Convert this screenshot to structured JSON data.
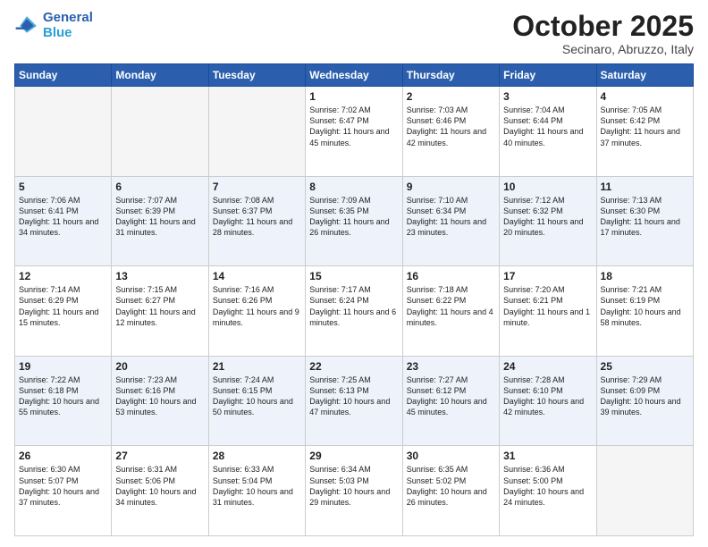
{
  "header": {
    "logo_general": "General",
    "logo_blue": "Blue",
    "month": "October 2025",
    "location": "Secinaro, Abruzzo, Italy"
  },
  "days_of_week": [
    "Sunday",
    "Monday",
    "Tuesday",
    "Wednesday",
    "Thursday",
    "Friday",
    "Saturday"
  ],
  "weeks": [
    [
      {
        "day": "",
        "info": ""
      },
      {
        "day": "",
        "info": ""
      },
      {
        "day": "",
        "info": ""
      },
      {
        "day": "1",
        "info": "Sunrise: 7:02 AM\nSunset: 6:47 PM\nDaylight: 11 hours\nand 45 minutes."
      },
      {
        "day": "2",
        "info": "Sunrise: 7:03 AM\nSunset: 6:46 PM\nDaylight: 11 hours\nand 42 minutes."
      },
      {
        "day": "3",
        "info": "Sunrise: 7:04 AM\nSunset: 6:44 PM\nDaylight: 11 hours\nand 40 minutes."
      },
      {
        "day": "4",
        "info": "Sunrise: 7:05 AM\nSunset: 6:42 PM\nDaylight: 11 hours\nand 37 minutes."
      }
    ],
    [
      {
        "day": "5",
        "info": "Sunrise: 7:06 AM\nSunset: 6:41 PM\nDaylight: 11 hours\nand 34 minutes."
      },
      {
        "day": "6",
        "info": "Sunrise: 7:07 AM\nSunset: 6:39 PM\nDaylight: 11 hours\nand 31 minutes."
      },
      {
        "day": "7",
        "info": "Sunrise: 7:08 AM\nSunset: 6:37 PM\nDaylight: 11 hours\nand 28 minutes."
      },
      {
        "day": "8",
        "info": "Sunrise: 7:09 AM\nSunset: 6:35 PM\nDaylight: 11 hours\nand 26 minutes."
      },
      {
        "day": "9",
        "info": "Sunrise: 7:10 AM\nSunset: 6:34 PM\nDaylight: 11 hours\nand 23 minutes."
      },
      {
        "day": "10",
        "info": "Sunrise: 7:12 AM\nSunset: 6:32 PM\nDaylight: 11 hours\nand 20 minutes."
      },
      {
        "day": "11",
        "info": "Sunrise: 7:13 AM\nSunset: 6:30 PM\nDaylight: 11 hours\nand 17 minutes."
      }
    ],
    [
      {
        "day": "12",
        "info": "Sunrise: 7:14 AM\nSunset: 6:29 PM\nDaylight: 11 hours\nand 15 minutes."
      },
      {
        "day": "13",
        "info": "Sunrise: 7:15 AM\nSunset: 6:27 PM\nDaylight: 11 hours\nand 12 minutes."
      },
      {
        "day": "14",
        "info": "Sunrise: 7:16 AM\nSunset: 6:26 PM\nDaylight: 11 hours\nand 9 minutes."
      },
      {
        "day": "15",
        "info": "Sunrise: 7:17 AM\nSunset: 6:24 PM\nDaylight: 11 hours\nand 6 minutes."
      },
      {
        "day": "16",
        "info": "Sunrise: 7:18 AM\nSunset: 6:22 PM\nDaylight: 11 hours\nand 4 minutes."
      },
      {
        "day": "17",
        "info": "Sunrise: 7:20 AM\nSunset: 6:21 PM\nDaylight: 11 hours\nand 1 minute."
      },
      {
        "day": "18",
        "info": "Sunrise: 7:21 AM\nSunset: 6:19 PM\nDaylight: 10 hours\nand 58 minutes."
      }
    ],
    [
      {
        "day": "19",
        "info": "Sunrise: 7:22 AM\nSunset: 6:18 PM\nDaylight: 10 hours\nand 55 minutes."
      },
      {
        "day": "20",
        "info": "Sunrise: 7:23 AM\nSunset: 6:16 PM\nDaylight: 10 hours\nand 53 minutes."
      },
      {
        "day": "21",
        "info": "Sunrise: 7:24 AM\nSunset: 6:15 PM\nDaylight: 10 hours\nand 50 minutes."
      },
      {
        "day": "22",
        "info": "Sunrise: 7:25 AM\nSunset: 6:13 PM\nDaylight: 10 hours\nand 47 minutes."
      },
      {
        "day": "23",
        "info": "Sunrise: 7:27 AM\nSunset: 6:12 PM\nDaylight: 10 hours\nand 45 minutes."
      },
      {
        "day": "24",
        "info": "Sunrise: 7:28 AM\nSunset: 6:10 PM\nDaylight: 10 hours\nand 42 minutes."
      },
      {
        "day": "25",
        "info": "Sunrise: 7:29 AM\nSunset: 6:09 PM\nDaylight: 10 hours\nand 39 minutes."
      }
    ],
    [
      {
        "day": "26",
        "info": "Sunrise: 6:30 AM\nSunset: 5:07 PM\nDaylight: 10 hours\nand 37 minutes."
      },
      {
        "day": "27",
        "info": "Sunrise: 6:31 AM\nSunset: 5:06 PM\nDaylight: 10 hours\nand 34 minutes."
      },
      {
        "day": "28",
        "info": "Sunrise: 6:33 AM\nSunset: 5:04 PM\nDaylight: 10 hours\nand 31 minutes."
      },
      {
        "day": "29",
        "info": "Sunrise: 6:34 AM\nSunset: 5:03 PM\nDaylight: 10 hours\nand 29 minutes."
      },
      {
        "day": "30",
        "info": "Sunrise: 6:35 AM\nSunset: 5:02 PM\nDaylight: 10 hours\nand 26 minutes."
      },
      {
        "day": "31",
        "info": "Sunrise: 6:36 AM\nSunset: 5:00 PM\nDaylight: 10 hours\nand 24 minutes."
      },
      {
        "day": "",
        "info": ""
      }
    ]
  ]
}
